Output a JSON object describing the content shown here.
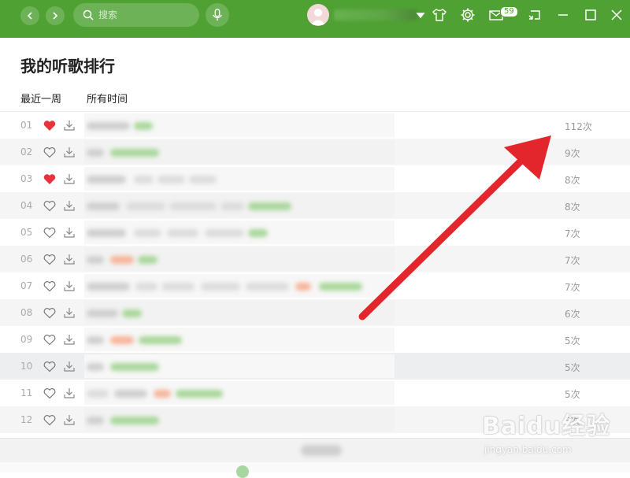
{
  "header": {
    "search_placeholder": "搜索",
    "username": "",
    "mail_count": "59",
    "accent": "#4fa133"
  },
  "page": {
    "title": "我的听歌排行",
    "tabs": [
      {
        "label": "最近一周"
      },
      {
        "label": "所有时间"
      }
    ]
  },
  "rows": [
    {
      "index": "01",
      "liked": true,
      "count": "112次",
      "title": ""
    },
    {
      "index": "02",
      "liked": false,
      "count": "9次",
      "title": ""
    },
    {
      "index": "03",
      "liked": true,
      "count": "8次",
      "title": ""
    },
    {
      "index": "04",
      "liked": false,
      "count": "8次",
      "title": ""
    },
    {
      "index": "05",
      "liked": false,
      "count": "7次",
      "title": ""
    },
    {
      "index": "06",
      "liked": false,
      "count": "7次",
      "title": ""
    },
    {
      "index": "07",
      "liked": false,
      "count": "7次",
      "title": ""
    },
    {
      "index": "08",
      "liked": false,
      "count": "6次",
      "title": ""
    },
    {
      "index": "09",
      "liked": false,
      "count": "5次",
      "title": ""
    },
    {
      "index": "10",
      "liked": false,
      "count": "5次",
      "title": ""
    },
    {
      "index": "11",
      "liked": false,
      "count": "5次",
      "title": ""
    },
    {
      "index": "12",
      "liked": false,
      "count": "5次",
      "title": ""
    }
  ],
  "icons": {
    "back": "chevron-left-icon",
    "forward": "chevron-right-icon",
    "search": "search-icon",
    "voice": "microphone-icon",
    "skin": "tshirt-icon",
    "settings": "gear-icon",
    "mail": "mail-icon",
    "mini": "mini-mode-icon",
    "minimize": "minimize-icon",
    "maximize": "maximize-icon",
    "close": "close-icon"
  },
  "colors": {
    "liked_heart": "#e8323c",
    "arrow": "#e3262b"
  },
  "watermark": {
    "text": "Baidu经验",
    "sub": "jingyan.baidu.com"
  }
}
